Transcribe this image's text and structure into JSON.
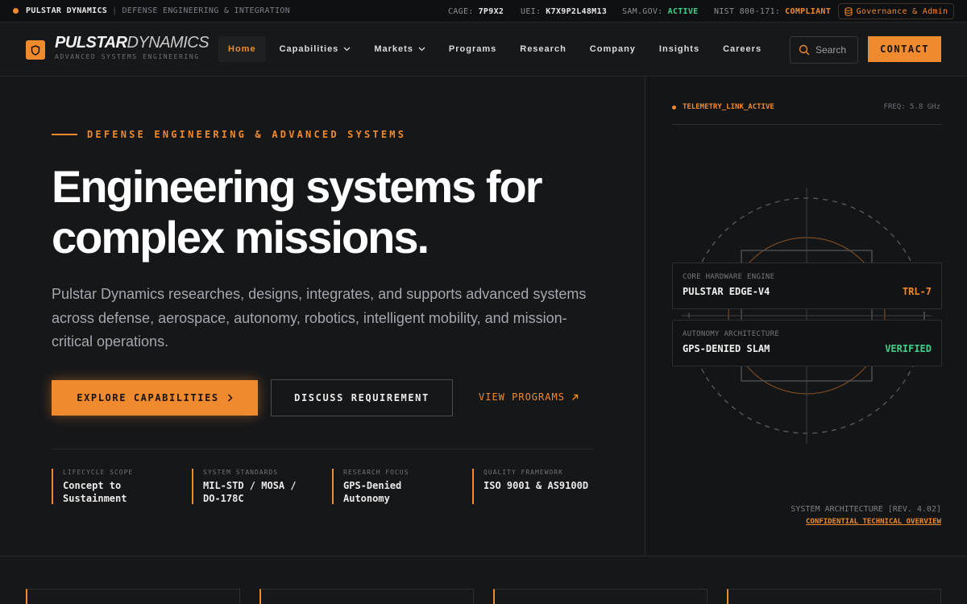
{
  "topbar": {
    "brand": "PULSTAR DYNAMICS",
    "separator": "|",
    "tagline": "DEFENSE ENGINEERING & INTEGRATION",
    "cage_label": "CAGE:",
    "cage_value": "7P9X2",
    "uei_label": "UEI:",
    "uei_value": "K7X9P2L48M13",
    "sam_label": "SAM.GOV:",
    "sam_value": "ACTIVE",
    "nist_label": "NIST 800-171:",
    "nist_value": "COMPLIANT",
    "admin_label": "Governance & Admin",
    "colors": {
      "active": "#3fd08a",
      "accent": "#f08a2e"
    }
  },
  "nav": {
    "logo_bold": "PULSTAR",
    "logo_light": "DYNAMICS",
    "logo_sub": "ADVANCED SYSTEMS ENGINEERING",
    "logo_icon": "shield-icon",
    "links": [
      {
        "label": "Home",
        "active": true
      },
      {
        "label": "Capabilities",
        "dropdown": true
      },
      {
        "label": "Markets",
        "dropdown": true
      },
      {
        "label": "Programs"
      },
      {
        "label": "Research"
      },
      {
        "label": "Company"
      },
      {
        "label": "Insights"
      },
      {
        "label": "Careers"
      }
    ],
    "search_placeholder": "Search",
    "contact_label": "CONTACT"
  },
  "hero": {
    "eyebrow": "DEFENSE ENGINEERING & ADVANCED SYSTEMS",
    "headline_line1": "Engineering systems for",
    "headline_line2": "complex missions.",
    "lede": "Pulstar Dynamics researches, designs, integrates, and supports advanced systems across defense, aerospace, autonomy, robotics, intelligent mobility, and mission-critical operations.",
    "primary_cta": "EXPLORE CAPABILITIES",
    "secondary_cta": "DISCUSS REQUIREMENT",
    "tertiary_cta": "VIEW PROGRAMS",
    "stats": [
      {
        "key": "LIFECYCLE SCOPE",
        "line1": "Concept to",
        "line2": "Sustainment"
      },
      {
        "key": "SYSTEM STANDARDS",
        "line1": "MIL-STD / MOSA /",
        "line2": "DO-178C"
      },
      {
        "key": "RESEARCH FOCUS",
        "line1": "GPS-Denied",
        "line2": "Autonomy"
      },
      {
        "key": "QUALITY FRAMEWORK",
        "line1": "ISO 9001 & AS9100D",
        "line2": ""
      }
    ]
  },
  "panel": {
    "telemetry": "TELEMETRY_LINK_ACTIVE",
    "freq": "FREQ: 5.8 GHz",
    "cards": [
      {
        "key": "CORE HARDWARE ENGINE",
        "value": "PULSTAR EDGE-V4",
        "status": "TRL-7",
        "status_color": "#f08a2e"
      },
      {
        "key": "AUTONOMY ARCHITECTURE",
        "value": "GPS-DENIED SLAM",
        "status": "VERIFIED",
        "status_color": "#3fd08a"
      }
    ],
    "arch_label": "SYSTEM ARCHITECTURE [REV. 4.02]",
    "conf_link": "CONFIDENTIAL_TECHNICAL_OVERVIEW"
  }
}
